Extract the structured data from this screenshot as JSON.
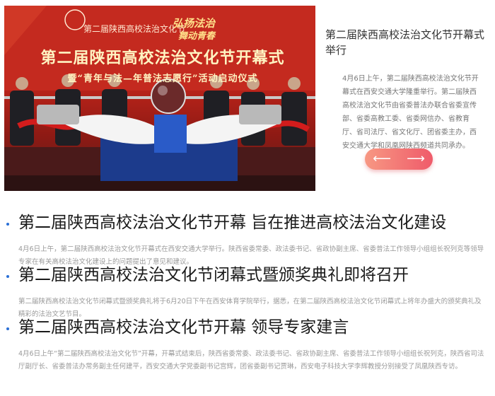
{
  "featured": {
    "banner_top": "第二届陕西高校法治文化节",
    "banner_logo_line1": "弘扬法治",
    "banner_logo_line2": "舞动青春",
    "banner_line1": "第二届陕西高校法治文化节开幕式",
    "banner_line2": "暨“青年与法—年普法志愿行”活动启动仪式",
    "title": "第二届陕西高校法治文化节开幕式举行",
    "description": "4月6日上午，第二届陕西高校法治文化节开幕式在西安交通大学隆重举行。第二届陕西高校法治文化节由省委普法办联合省委宣传部、省委高教工委、省委网信办、省教育厅、省司法厅、省文化厅、团省委主办，西安交通大学和凤凰网陕西频道共同承办。",
    "prev_label": "⟵",
    "next_label": "⟶"
  },
  "news": [
    {
      "title": "第二届陕西高校法治文化节开幕 旨在推进高校法治文化建设",
      "description": "4月6日上午，第二届陕西高校法治文化节开幕式在西安交通大学举行。陕西省委常委、政法委书记、省政协副主席、省委普法工作领导小组组长祝列克等领导专家在有关高校法治文化建设上的问题提出了意见和建议。"
    },
    {
      "title": "第二届陕西高校法治文化节闭幕式暨颁奖典礼即将召开",
      "description": "第二届陕西高校法治文化节闭幕式暨颁奖典礼将于6月20日下午在西安体育学院举行，据悉，在第二届陕西高校法治文化节闭幕式上将年办盛大的颁奖典礼及精彩的法治文艺节目。"
    },
    {
      "title": "第二届陕西高校法治文化节开幕 领导专家建言",
      "description": "4月6日上午“第二届陕西高校法治文化节”开幕，开幕式结束后，陕西省委常委、政法委书记、省政协副主席、省委普法工作领导小组组长祝列克，陕西省司法厅副厅长、省委普法办常务副主任何建平，西安交通大学党委副书记宫辉，团省委副书记贾琳，西安电子科技大学李辉教授分别接受了凤凰陕西专访。"
    }
  ]
}
